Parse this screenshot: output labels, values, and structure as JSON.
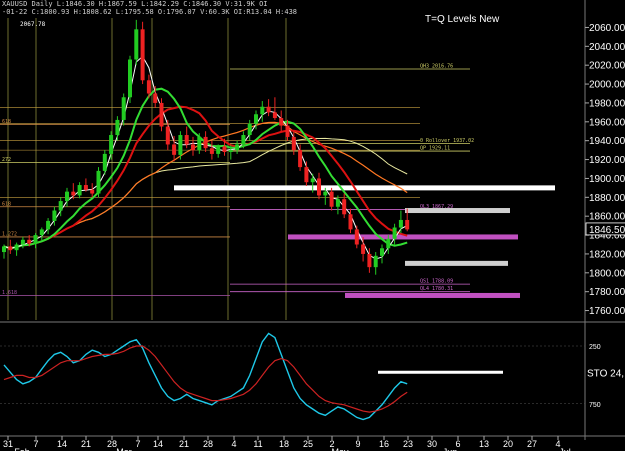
{
  "header": {
    "line1": "XAUUSD Daily  L:1846.30  H:1867.59  L:1842.29  C:1846.30  V:31.9K  OI",
    "line2": "-01-22  C:1800.93  H:1808.62  L:1795.58  O:1796.07  V:60.3K  OI:R13.04  H:438"
  },
  "title": "T=Q Levels New",
  "high_label": "2067.78",
  "current_price": "1846.50",
  "osc_label": "STO  24,",
  "colors": {
    "background": "#000000",
    "bull": "#22cc22",
    "bear": "#ee2222",
    "fast_ma": "#ffffff",
    "mid_ma": "#33dd33",
    "slow_ma": "#ff7722",
    "red_ma": "#dd1111",
    "long_ma": "#e8e8a0",
    "osc_main": "#1ec8e8",
    "osc_signal": "#cc2222"
  },
  "chart_data": [
    {
      "type": "candlestick",
      "ylim": [
        1750,
        2070
      ],
      "y_ticks": [
        2060,
        2040,
        2020,
        2000,
        1980,
        1960,
        1940,
        1920,
        1900,
        1880,
        1860,
        1840,
        1820,
        1800,
        1780,
        1760
      ],
      "x_tick_labels": [
        "31",
        "7",
        "14",
        "21",
        "28",
        "7",
        "14",
        "21",
        "28",
        "4",
        "11",
        "18",
        "25",
        "2",
        "9",
        "16",
        "23",
        "30",
        "6",
        "13",
        "20",
        "27",
        "4"
      ],
      "month_labels": [
        "Feb",
        "Mar",
        "May",
        "Jun",
        "Jul"
      ],
      "level_labels": [
        {
          "text": "QH3  2016.76",
          "price": 2016
        },
        {
          "text": "0 Rollover 1937.02",
          "price": 1937
        },
        {
          "text": "QP  1929.11",
          "price": 1929
        },
        {
          "text": "QL3  1867.29",
          "price": 1867
        },
        {
          "text": "QS1  1788.09",
          "price": 1788
        },
        {
          "text": "QL4  1780.31",
          "price": 1780
        },
        {
          "text": "1.272",
          "price": 1838
        },
        {
          "text": "1.618",
          "price": 1776
        },
        {
          "text": "618",
          "price": 1957
        },
        {
          "text": "272",
          "price": 1917
        },
        {
          "text": "618",
          "price": 1870
        }
      ],
      "zones": [
        {
          "price": 1890,
          "color": "#ffffff"
        },
        {
          "price": 1866,
          "color": "#cfcfcf"
        },
        {
          "price": 1838,
          "color": "#c050c0"
        },
        {
          "price": 1810,
          "color": "#cfcfcf"
        },
        {
          "price": 1776,
          "color": "#c050c0"
        }
      ],
      "candles": [
        [
          1822,
          1830,
          1815,
          1828
        ],
        [
          1828,
          1835,
          1820,
          1824
        ],
        [
          1824,
          1832,
          1818,
          1830
        ],
        [
          1830,
          1838,
          1826,
          1835
        ],
        [
          1835,
          1840,
          1828,
          1831
        ],
        [
          1831,
          1842,
          1826,
          1840
        ],
        [
          1840,
          1848,
          1834,
          1846
        ],
        [
          1846,
          1858,
          1841,
          1855
        ],
        [
          1855,
          1870,
          1850,
          1866
        ],
        [
          1866,
          1880,
          1860,
          1876
        ],
        [
          1876,
          1890,
          1870,
          1886
        ],
        [
          1886,
          1895,
          1878,
          1882
        ],
        [
          1882,
          1896,
          1879,
          1893
        ],
        [
          1893,
          1900,
          1886,
          1888
        ],
        [
          1888,
          1895,
          1880,
          1884
        ],
        [
          1884,
          1912,
          1880,
          1908
        ],
        [
          1908,
          1930,
          1904,
          1926
        ],
        [
          1926,
          1950,
          1920,
          1946
        ],
        [
          1946,
          1966,
          1940,
          1962
        ],
        [
          1962,
          1990,
          1956,
          1986
        ],
        [
          1986,
          2030,
          1980,
          2026
        ],
        [
          2026,
          2068,
          2020,
          2058
        ],
        [
          2058,
          2066,
          2000,
          2004
        ],
        [
          2004,
          2010,
          1985,
          1990
        ],
        [
          1990,
          1998,
          1975,
          1980
        ],
        [
          1980,
          1985,
          1950,
          1955
        ],
        [
          1955,
          1962,
          1930,
          1936
        ],
        [
          1936,
          1945,
          1918,
          1925
        ],
        [
          1925,
          1950,
          1920,
          1946
        ],
        [
          1946,
          1955,
          1932,
          1936
        ],
        [
          1936,
          1944,
          1924,
          1930
        ],
        [
          1930,
          1948,
          1926,
          1944
        ],
        [
          1944,
          1950,
          1928,
          1932
        ],
        [
          1932,
          1940,
          1920,
          1926
        ],
        [
          1926,
          1936,
          1922,
          1934
        ],
        [
          1934,
          1942,
          1924,
          1928
        ],
        [
          1928,
          1935,
          1920,
          1930
        ],
        [
          1930,
          1940,
          1926,
          1936
        ],
        [
          1936,
          1950,
          1932,
          1946
        ],
        [
          1946,
          1962,
          1940,
          1958
        ],
        [
          1958,
          1972,
          1952,
          1968
        ],
        [
          1968,
          1982,
          1960,
          1976
        ],
        [
          1976,
          1984,
          1966,
          1970
        ],
        [
          1970,
          1986,
          1962,
          1964
        ],
        [
          1964,
          1972,
          1950,
          1956
        ],
        [
          1956,
          1962,
          1940,
          1944
        ],
        [
          1944,
          1950,
          1925,
          1930
        ],
        [
          1930,
          1936,
          1908,
          1912
        ],
        [
          1912,
          1918,
          1892,
          1896
        ],
        [
          1896,
          1905,
          1885,
          1900
        ],
        [
          1900,
          1906,
          1878,
          1882
        ],
        [
          1882,
          1890,
          1872,
          1886
        ],
        [
          1886,
          1890,
          1866,
          1870
        ],
        [
          1870,
          1882,
          1862,
          1878
        ],
        [
          1878,
          1884,
          1858,
          1862
        ],
        [
          1862,
          1868,
          1842,
          1846
        ],
        [
          1846,
          1850,
          1826,
          1830
        ],
        [
          1830,
          1838,
          1812,
          1820
        ],
        [
          1820,
          1826,
          1800,
          1806
        ],
        [
          1806,
          1822,
          1798,
          1818
        ],
        [
          1818,
          1830,
          1810,
          1826
        ],
        [
          1826,
          1840,
          1820,
          1836
        ],
        [
          1836,
          1852,
          1830,
          1848
        ],
        [
          1848,
          1866,
          1842,
          1856
        ],
        [
          1856,
          1868,
          1844,
          1846
        ]
      ]
    },
    {
      "type": "line",
      "name": "STO",
      "ylim": [
        0,
        100
      ],
      "y_tick_labels": [
        {
          "text": "250",
          "value": 80
        },
        {
          "text": "750",
          "value": 25
        }
      ],
      "series": [
        {
          "values": [
            62,
            55,
            48,
            44,
            46,
            50,
            58,
            66,
            72,
            74,
            70,
            64,
            66,
            72,
            76,
            74,
            70,
            72,
            76,
            80,
            84,
            86,
            78,
            64,
            52,
            40,
            32,
            28,
            30,
            34,
            30,
            28,
            26,
            24,
            28,
            30,
            32,
            36,
            40,
            52,
            68,
            84,
            92,
            88,
            72,
            56,
            40,
            30,
            24,
            20,
            16,
            14,
            18,
            22,
            20,
            16,
            12,
            10,
            12,
            18,
            24,
            32,
            40,
            46,
            44
          ]
        },
        {
          "values": [
            48,
            50,
            52,
            52,
            50,
            50,
            52,
            56,
            60,
            64,
            66,
            66,
            66,
            68,
            70,
            71,
            72,
            72,
            73,
            75,
            78,
            80,
            80,
            76,
            70,
            62,
            54,
            46,
            40,
            36,
            34,
            32,
            30,
            28,
            28,
            29,
            30,
            32,
            34,
            38,
            44,
            52,
            60,
            66,
            68,
            66,
            60,
            52,
            44,
            38,
            32,
            28,
            26,
            25,
            24,
            22,
            20,
            18,
            17,
            18,
            20,
            23,
            27,
            32,
            36
          ]
        }
      ]
    }
  ]
}
